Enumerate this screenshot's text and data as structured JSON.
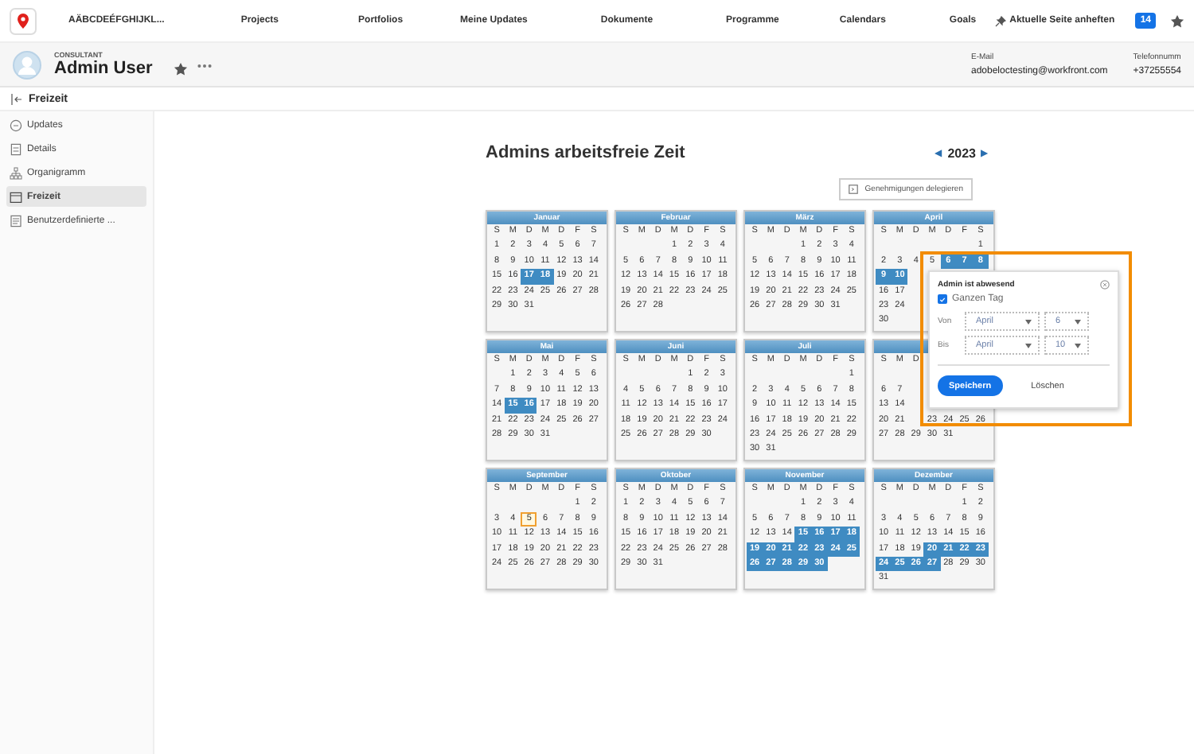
{
  "top_nav": {
    "brand": "AÄBCDEÉFGHIJKL...",
    "items": [
      "Projects",
      "Portfolios",
      "Meine Updates",
      "Dokumente",
      "Programme",
      "Calendars",
      "Goals"
    ],
    "pin": "Aktuelle Seite anheften",
    "badge": "14"
  },
  "profile": {
    "role": "CONSULTANT",
    "name": "Admin User",
    "fields": [
      {
        "label": "E-Mail",
        "value": "adobeloctesting@workfront.com"
      },
      {
        "label": "Telefonnumm",
        "value": "+37255554"
      }
    ]
  },
  "section": {
    "title": "Freizeit"
  },
  "sidebar": {
    "items": [
      {
        "label": "Updates",
        "selected": false
      },
      {
        "label": "Details",
        "selected": false
      },
      {
        "label": "Organigramm",
        "selected": false
      },
      {
        "label": "Freizeit",
        "selected": true
      },
      {
        "label": "Benutzerdefinierte ...",
        "selected": false
      }
    ]
  },
  "page": {
    "title": "Admins arbeitsfreie Zeit",
    "year": "2023",
    "prev": "◀",
    "next": "▶",
    "delegate_button": "Genehmigungen delegieren"
  },
  "months": [
    {
      "title": "Januar",
      "weekdays": [
        "S",
        "M",
        "D",
        "M",
        "D",
        "F",
        "S"
      ],
      "weeks": [
        [
          {
            "day": "1",
            "kind": "plain"
          },
          {
            "day": "2",
            "kind": "plain"
          },
          {
            "day": "3",
            "kind": "plain"
          },
          {
            "day": "4",
            "kind": "plain"
          },
          {
            "day": "5",
            "kind": "plain"
          },
          {
            "day": "6",
            "kind": "plain"
          },
          {
            "day": "7",
            "kind": "plain"
          }
        ],
        [
          {
            "day": "8",
            "kind": "plain"
          },
          {
            "day": "9",
            "kind": "plain"
          },
          {
            "day": "10",
            "kind": "plain"
          },
          {
            "day": "11",
            "kind": "plain"
          },
          {
            "day": "12",
            "kind": "plain"
          },
          {
            "day": "13",
            "kind": "plain"
          },
          {
            "day": "14",
            "kind": "plain"
          }
        ],
        [
          {
            "day": "15",
            "kind": "plain"
          },
          {
            "day": "16",
            "kind": "plain"
          },
          {
            "day": "17",
            "kind": "off"
          },
          {
            "day": "18",
            "kind": "off"
          },
          {
            "day": "19",
            "kind": "plain"
          },
          {
            "day": "20",
            "kind": "plain"
          },
          {
            "day": "21",
            "kind": "plain"
          }
        ],
        [
          {
            "day": "22",
            "kind": "plain"
          },
          {
            "day": "23",
            "kind": "plain"
          },
          {
            "day": "24",
            "kind": "plain"
          },
          {
            "day": "25",
            "kind": "plain"
          },
          {
            "day": "26",
            "kind": "plain"
          },
          {
            "day": "27",
            "kind": "plain"
          },
          {
            "day": "28",
            "kind": "plain"
          }
        ],
        [
          {
            "day": "29",
            "kind": "plain"
          },
          {
            "day": "30",
            "kind": "plain"
          },
          {
            "day": "31",
            "kind": "plain"
          }
        ]
      ]
    },
    {
      "title": "Februar",
      "weekdays": [
        "S",
        "M",
        "D",
        "M",
        "D",
        "F",
        "S"
      ],
      "weeks": [
        [
          {
            "kind": "blank"
          },
          {
            "kind": "blank"
          },
          {
            "kind": "blank"
          },
          {
            "day": "1",
            "kind": "plain"
          },
          {
            "day": "2",
            "kind": "plain"
          },
          {
            "day": "3",
            "kind": "plain"
          },
          {
            "day": "4",
            "kind": "plain"
          }
        ],
        [
          {
            "day": "5",
            "kind": "plain"
          },
          {
            "day": "6",
            "kind": "plain"
          },
          {
            "day": "7",
            "kind": "plain"
          },
          {
            "day": "8",
            "kind": "plain"
          },
          {
            "day": "9",
            "kind": "plain"
          },
          {
            "day": "10",
            "kind": "plain"
          },
          {
            "day": "11",
            "kind": "plain"
          }
        ],
        [
          {
            "day": "12",
            "kind": "plain"
          },
          {
            "day": "13",
            "kind": "plain"
          },
          {
            "day": "14",
            "kind": "plain"
          },
          {
            "day": "15",
            "kind": "plain"
          },
          {
            "day": "16",
            "kind": "plain"
          },
          {
            "day": "17",
            "kind": "plain"
          },
          {
            "day": "18",
            "kind": "plain"
          }
        ],
        [
          {
            "day": "19",
            "kind": "plain"
          },
          {
            "day": "20",
            "kind": "plain"
          },
          {
            "day": "21",
            "kind": "plain"
          },
          {
            "day": "22",
            "kind": "plain"
          },
          {
            "day": "23",
            "kind": "plain"
          },
          {
            "day": "24",
            "kind": "plain"
          },
          {
            "day": "25",
            "kind": "plain"
          }
        ],
        [
          {
            "day": "26",
            "kind": "plain"
          },
          {
            "day": "27",
            "kind": "plain"
          },
          {
            "day": "28",
            "kind": "plain"
          }
        ]
      ]
    },
    {
      "title": "März",
      "weekdays": [
        "S",
        "M",
        "D",
        "M",
        "D",
        "F",
        "S"
      ],
      "weeks": [
        [
          {
            "kind": "blank"
          },
          {
            "kind": "blank"
          },
          {
            "kind": "blank"
          },
          {
            "day": "1",
            "kind": "plain"
          },
          {
            "day": "2",
            "kind": "plain"
          },
          {
            "day": "3",
            "kind": "plain"
          },
          {
            "day": "4",
            "kind": "plain"
          }
        ],
        [
          {
            "day": "5",
            "kind": "plain"
          },
          {
            "day": "6",
            "kind": "plain"
          },
          {
            "day": "7",
            "kind": "plain"
          },
          {
            "day": "8",
            "kind": "plain"
          },
          {
            "day": "9",
            "kind": "plain"
          },
          {
            "day": "10",
            "kind": "plain"
          },
          {
            "day": "11",
            "kind": "plain"
          }
        ],
        [
          {
            "day": "12",
            "kind": "plain"
          },
          {
            "day": "13",
            "kind": "plain"
          },
          {
            "day": "14",
            "kind": "plain"
          },
          {
            "day": "15",
            "kind": "plain"
          },
          {
            "day": "16",
            "kind": "plain"
          },
          {
            "day": "17",
            "kind": "plain"
          },
          {
            "day": "18",
            "kind": "plain"
          }
        ],
        [
          {
            "day": "19",
            "kind": "plain"
          },
          {
            "day": "20",
            "kind": "plain"
          },
          {
            "day": "21",
            "kind": "plain"
          },
          {
            "day": "22",
            "kind": "plain"
          },
          {
            "day": "23",
            "kind": "plain"
          },
          {
            "day": "24",
            "kind": "plain"
          },
          {
            "day": "25",
            "kind": "plain"
          }
        ],
        [
          {
            "day": "26",
            "kind": "plain"
          },
          {
            "day": "27",
            "kind": "plain"
          },
          {
            "day": "28",
            "kind": "plain"
          },
          {
            "day": "29",
            "kind": "plain"
          },
          {
            "day": "30",
            "kind": "plain"
          },
          {
            "day": "31",
            "kind": "plain"
          }
        ]
      ]
    },
    {
      "title": "April",
      "weekdays": [
        "S",
        "M",
        "D",
        "M",
        "D",
        "F",
        "S"
      ],
      "weeks": [
        [
          {
            "kind": "blank"
          },
          {
            "kind": "blank"
          },
          {
            "kind": "blank"
          },
          {
            "kind": "blank"
          },
          {
            "kind": "blank"
          },
          {
            "kind": "blank"
          },
          {
            "day": "1",
            "kind": "plain"
          }
        ],
        [
          {
            "day": "2",
            "kind": "plain"
          },
          {
            "day": "3",
            "kind": "plain"
          },
          {
            "day": "4",
            "kind": "plain"
          },
          {
            "day": "5",
            "kind": "plain"
          },
          {
            "day": "6",
            "kind": "off"
          },
          {
            "day": "7",
            "kind": "off"
          },
          {
            "day": "8",
            "kind": "off"
          }
        ],
        [
          {
            "day": "9",
            "kind": "off"
          },
          {
            "day": "10",
            "kind": "off"
          }
        ],
        [
          {
            "day": "16",
            "kind": "plain"
          },
          {
            "day": "17",
            "kind": "plain"
          }
        ],
        [
          {
            "day": "23",
            "kind": "plain"
          },
          {
            "day": "24",
            "kind": "plain"
          }
        ],
        [
          {
            "day": "30",
            "kind": "plain"
          }
        ]
      ]
    },
    {
      "title": "Mai",
      "weekdays": [
        "S",
        "M",
        "D",
        "M",
        "D",
        "F",
        "S"
      ],
      "weeks": [
        [
          {
            "kind": "blank"
          },
          {
            "day": "1",
            "kind": "plain"
          },
          {
            "day": "2",
            "kind": "plain"
          },
          {
            "day": "3",
            "kind": "plain"
          },
          {
            "day": "4",
            "kind": "plain"
          },
          {
            "day": "5",
            "kind": "plain"
          },
          {
            "day": "6",
            "kind": "plain"
          }
        ],
        [
          {
            "day": "7",
            "kind": "plain"
          },
          {
            "day": "8",
            "kind": "plain"
          },
          {
            "day": "9",
            "kind": "plain"
          },
          {
            "day": "10",
            "kind": "plain"
          },
          {
            "day": "11",
            "kind": "plain"
          },
          {
            "day": "12",
            "kind": "plain"
          },
          {
            "day": "13",
            "kind": "plain"
          }
        ],
        [
          {
            "day": "14",
            "kind": "plain"
          },
          {
            "day": "15",
            "kind": "off"
          },
          {
            "day": "16",
            "kind": "off"
          },
          {
            "day": "17",
            "kind": "plain"
          },
          {
            "day": "18",
            "kind": "plain"
          },
          {
            "day": "19",
            "kind": "plain"
          },
          {
            "day": "20",
            "kind": "plain"
          }
        ],
        [
          {
            "day": "21",
            "kind": "plain"
          },
          {
            "day": "22",
            "kind": "plain"
          },
          {
            "day": "23",
            "kind": "plain"
          },
          {
            "day": "24",
            "kind": "plain"
          },
          {
            "day": "25",
            "kind": "plain"
          },
          {
            "day": "26",
            "kind": "plain"
          },
          {
            "day": "27",
            "kind": "plain"
          }
        ],
        [
          {
            "day": "28",
            "kind": "plain"
          },
          {
            "day": "29",
            "kind": "plain"
          },
          {
            "day": "30",
            "kind": "plain"
          },
          {
            "day": "31",
            "kind": "plain"
          }
        ]
      ]
    },
    {
      "title": "Juni",
      "weekdays": [
        "S",
        "M",
        "D",
        "M",
        "D",
        "F",
        "S"
      ],
      "weeks": [
        [
          {
            "kind": "blank"
          },
          {
            "kind": "blank"
          },
          {
            "kind": "blank"
          },
          {
            "kind": "blank"
          },
          {
            "day": "1",
            "kind": "plain"
          },
          {
            "day": "2",
            "kind": "plain"
          },
          {
            "day": "3",
            "kind": "plain"
          }
        ],
        [
          {
            "day": "4",
            "kind": "plain"
          },
          {
            "day": "5",
            "kind": "plain"
          },
          {
            "day": "6",
            "kind": "plain"
          },
          {
            "day": "7",
            "kind": "plain"
          },
          {
            "day": "8",
            "kind": "plain"
          },
          {
            "day": "9",
            "kind": "plain"
          },
          {
            "day": "10",
            "kind": "plain"
          }
        ],
        [
          {
            "day": "11",
            "kind": "plain"
          },
          {
            "day": "12",
            "kind": "plain"
          },
          {
            "day": "13",
            "kind": "plain"
          },
          {
            "day": "14",
            "kind": "plain"
          },
          {
            "day": "15",
            "kind": "plain"
          },
          {
            "day": "16",
            "kind": "plain"
          },
          {
            "day": "17",
            "kind": "plain"
          }
        ],
        [
          {
            "day": "18",
            "kind": "plain"
          },
          {
            "day": "19",
            "kind": "plain"
          },
          {
            "day": "20",
            "kind": "plain"
          },
          {
            "day": "21",
            "kind": "plain"
          },
          {
            "day": "22",
            "kind": "plain"
          },
          {
            "day": "23",
            "kind": "plain"
          },
          {
            "day": "24",
            "kind": "plain"
          }
        ],
        [
          {
            "day": "25",
            "kind": "plain"
          },
          {
            "day": "26",
            "kind": "plain"
          },
          {
            "day": "27",
            "kind": "plain"
          },
          {
            "day": "28",
            "kind": "plain"
          },
          {
            "day": "29",
            "kind": "plain"
          },
          {
            "day": "30",
            "kind": "plain"
          }
        ]
      ]
    },
    {
      "title": "Juli",
      "weekdays": [
        "S",
        "M",
        "D",
        "M",
        "D",
        "F",
        "S"
      ],
      "weeks": [
        [
          {
            "kind": "blank"
          },
          {
            "kind": "blank"
          },
          {
            "kind": "blank"
          },
          {
            "kind": "blank"
          },
          {
            "kind": "blank"
          },
          {
            "kind": "blank"
          },
          {
            "day": "1",
            "kind": "plain"
          }
        ],
        [
          {
            "day": "2",
            "kind": "plain"
          },
          {
            "day": "3",
            "kind": "plain"
          },
          {
            "day": "4",
            "kind": "plain"
          },
          {
            "day": "5",
            "kind": "plain"
          },
          {
            "day": "6",
            "kind": "plain"
          },
          {
            "day": "7",
            "kind": "plain"
          },
          {
            "day": "8",
            "kind": "plain"
          }
        ],
        [
          {
            "day": "9",
            "kind": "plain"
          },
          {
            "day": "10",
            "kind": "plain"
          },
          {
            "day": "11",
            "kind": "plain"
          },
          {
            "day": "12",
            "kind": "plain"
          },
          {
            "day": "13",
            "kind": "plain"
          },
          {
            "day": "14",
            "kind": "plain"
          },
          {
            "day": "15",
            "kind": "plain"
          }
        ],
        [
          {
            "day": "16",
            "kind": "plain"
          },
          {
            "day": "17",
            "kind": "plain"
          },
          {
            "day": "18",
            "kind": "plain"
          },
          {
            "day": "19",
            "kind": "plain"
          },
          {
            "day": "20",
            "kind": "plain"
          },
          {
            "day": "21",
            "kind": "plain"
          },
          {
            "day": "22",
            "kind": "plain"
          }
        ],
        [
          {
            "day": "23",
            "kind": "plain"
          },
          {
            "day": "24",
            "kind": "plain"
          },
          {
            "day": "25",
            "kind": "plain"
          },
          {
            "day": "26",
            "kind": "plain"
          },
          {
            "day": "27",
            "kind": "plain"
          },
          {
            "day": "28",
            "kind": "plain"
          },
          {
            "day": "29",
            "kind": "plain"
          }
        ],
        [
          {
            "day": "30",
            "kind": "plain"
          },
          {
            "day": "31",
            "kind": "plain"
          }
        ]
      ]
    },
    {
      "weekdays": [
        "S",
        "M",
        "D"
      ],
      "weeks": [
        [
          {
            "kind": "blank"
          }
        ],
        [
          {
            "day": "6",
            "kind": "plain"
          },
          {
            "day": "7",
            "kind": "plain"
          }
        ],
        [
          {
            "day": "13",
            "kind": "plain"
          },
          {
            "day": "14",
            "kind": "plain"
          }
        ],
        [
          {
            "day": "20",
            "kind": "plain"
          },
          {
            "day": "21",
            "kind": "plain"
          },
          {
            "kind": "blank"
          },
          {
            "day": "23",
            "kind": "plain"
          },
          {
            "day": "24",
            "kind": "plain"
          },
          {
            "day": "25",
            "kind": "plain"
          },
          {
            "day": "26",
            "kind": "plain"
          }
        ],
        [
          {
            "day": "27",
            "kind": "plain"
          },
          {
            "day": "28",
            "kind": "plain"
          },
          {
            "day": "29",
            "kind": "plain"
          },
          {
            "day": "30",
            "kind": "plain"
          },
          {
            "day": "31",
            "kind": "plain"
          }
        ]
      ]
    },
    {
      "title": "September",
      "weekdays": [
        "S",
        "M",
        "D",
        "M",
        "D",
        "F",
        "S"
      ],
      "weeks": [
        [
          {
            "kind": "blank"
          },
          {
            "kind": "blank"
          },
          {
            "kind": "blank"
          },
          {
            "kind": "blank"
          },
          {
            "kind": "blank"
          },
          {
            "day": "1",
            "kind": "plain"
          },
          {
            "day": "2",
            "kind": "plain"
          }
        ],
        [
          {
            "day": "3",
            "kind": "plain"
          },
          {
            "day": "4",
            "kind": "plain"
          },
          {
            "day": "5",
            "kind": "today"
          },
          {
            "day": "6",
            "kind": "plain"
          },
          {
            "day": "7",
            "kind": "plain"
          },
          {
            "day": "8",
            "kind": "plain"
          },
          {
            "day": "9",
            "kind": "plain"
          }
        ],
        [
          {
            "day": "10",
            "kind": "plain"
          },
          {
            "day": "11",
            "kind": "plain"
          },
          {
            "day": "12",
            "kind": "plain"
          },
          {
            "day": "13",
            "kind": "plain"
          },
          {
            "day": "14",
            "kind": "plain"
          },
          {
            "day": "15",
            "kind": "plain"
          },
          {
            "day": "16",
            "kind": "plain"
          }
        ],
        [
          {
            "day": "17",
            "kind": "plain"
          },
          {
            "day": "18",
            "kind": "plain"
          },
          {
            "day": "19",
            "kind": "plain"
          },
          {
            "day": "20",
            "kind": "plain"
          },
          {
            "day": "21",
            "kind": "plain"
          },
          {
            "day": "22",
            "kind": "plain"
          },
          {
            "day": "23",
            "kind": "plain"
          }
        ],
        [
          {
            "day": "24",
            "kind": "plain"
          },
          {
            "day": "25",
            "kind": "plain"
          },
          {
            "day": "26",
            "kind": "plain"
          },
          {
            "day": "27",
            "kind": "plain"
          },
          {
            "day": "28",
            "kind": "plain"
          },
          {
            "day": "29",
            "kind": "plain"
          },
          {
            "day": "30",
            "kind": "plain"
          }
        ]
      ]
    },
    {
      "title": "Oktober",
      "weekdays": [
        "S",
        "M",
        "D",
        "M",
        "D",
        "F",
        "S"
      ],
      "weeks": [
        [
          {
            "day": "1",
            "kind": "plain"
          },
          {
            "day": "2",
            "kind": "plain"
          },
          {
            "day": "3",
            "kind": "plain"
          },
          {
            "day": "4",
            "kind": "plain"
          },
          {
            "day": "5",
            "kind": "plain"
          },
          {
            "day": "6",
            "kind": "plain"
          },
          {
            "day": "7",
            "kind": "plain"
          }
        ],
        [
          {
            "day": "8",
            "kind": "plain"
          },
          {
            "day": "9",
            "kind": "plain"
          },
          {
            "day": "10",
            "kind": "plain"
          },
          {
            "day": "11",
            "kind": "plain"
          },
          {
            "day": "12",
            "kind": "plain"
          },
          {
            "day": "13",
            "kind": "plain"
          },
          {
            "day": "14",
            "kind": "plain"
          }
        ],
        [
          {
            "day": "15",
            "kind": "plain"
          },
          {
            "day": "16",
            "kind": "plain"
          },
          {
            "day": "17",
            "kind": "plain"
          },
          {
            "day": "18",
            "kind": "plain"
          },
          {
            "day": "19",
            "kind": "plain"
          },
          {
            "day": "20",
            "kind": "plain"
          },
          {
            "day": "21",
            "kind": "plain"
          }
        ],
        [
          {
            "day": "22",
            "kind": "plain"
          },
          {
            "day": "23",
            "kind": "plain"
          },
          {
            "day": "24",
            "kind": "plain"
          },
          {
            "day": "25",
            "kind": "plain"
          },
          {
            "day": "26",
            "kind": "plain"
          },
          {
            "day": "27",
            "kind": "plain"
          },
          {
            "day": "28",
            "kind": "plain"
          }
        ],
        [
          {
            "day": "29",
            "kind": "plain"
          },
          {
            "day": "30",
            "kind": "plain"
          },
          {
            "day": "31",
            "kind": "plain"
          }
        ]
      ]
    },
    {
      "title": "November",
      "weekdays": [
        "S",
        "M",
        "D",
        "M",
        "D",
        "F",
        "S"
      ],
      "weeks": [
        [
          {
            "kind": "blank"
          },
          {
            "kind": "blank"
          },
          {
            "kind": "blank"
          },
          {
            "day": "1",
            "kind": "plain"
          },
          {
            "day": "2",
            "kind": "plain"
          },
          {
            "day": "3",
            "kind": "plain"
          },
          {
            "day": "4",
            "kind": "plain"
          }
        ],
        [
          {
            "day": "5",
            "kind": "plain"
          },
          {
            "day": "6",
            "kind": "plain"
          },
          {
            "day": "7",
            "kind": "plain"
          },
          {
            "day": "8",
            "kind": "plain"
          },
          {
            "day": "9",
            "kind": "plain"
          },
          {
            "day": "10",
            "kind": "plain"
          },
          {
            "day": "11",
            "kind": "plain"
          }
        ],
        [
          {
            "day": "12",
            "kind": "plain"
          },
          {
            "day": "13",
            "kind": "plain"
          },
          {
            "day": "14",
            "kind": "plain"
          },
          {
            "day": "15",
            "kind": "off"
          },
          {
            "day": "16",
            "kind": "off"
          },
          {
            "day": "17",
            "kind": "off"
          },
          {
            "day": "18",
            "kind": "off"
          }
        ],
        [
          {
            "day": "19",
            "kind": "off"
          },
          {
            "day": "20",
            "kind": "off"
          },
          {
            "day": "21",
            "kind": "off"
          },
          {
            "day": "22",
            "kind": "off"
          },
          {
            "day": "23",
            "kind": "off"
          },
          {
            "day": "24",
            "kind": "off"
          },
          {
            "day": "25",
            "kind": "off"
          }
        ],
        [
          {
            "day": "26",
            "kind": "off"
          },
          {
            "day": "27",
            "kind": "off"
          },
          {
            "day": "28",
            "kind": "off"
          },
          {
            "day": "29",
            "kind": "off"
          },
          {
            "day": "30",
            "kind": "off"
          }
        ]
      ]
    },
    {
      "title": "Dezember",
      "weekdays": [
        "S",
        "M",
        "D",
        "M",
        "D",
        "F",
        "S"
      ],
      "weeks": [
        [
          {
            "kind": "blank"
          },
          {
            "kind": "blank"
          },
          {
            "kind": "blank"
          },
          {
            "kind": "blank"
          },
          {
            "kind": "blank"
          },
          {
            "day": "1",
            "kind": "plain"
          },
          {
            "day": "2",
            "kind": "plain"
          }
        ],
        [
          {
            "day": "3",
            "kind": "plain"
          },
          {
            "day": "4",
            "kind": "plain"
          },
          {
            "day": "5",
            "kind": "plain"
          },
          {
            "day": "6",
            "kind": "plain"
          },
          {
            "day": "7",
            "kind": "plain"
          },
          {
            "day": "8",
            "kind": "plain"
          },
          {
            "day": "9",
            "kind": "plain"
          }
        ],
        [
          {
            "day": "10",
            "kind": "plain"
          },
          {
            "day": "11",
            "kind": "plain"
          },
          {
            "day": "12",
            "kind": "plain"
          },
          {
            "day": "13",
            "kind": "plain"
          },
          {
            "day": "14",
            "kind": "plain"
          },
          {
            "day": "15",
            "kind": "plain"
          },
          {
            "day": "16",
            "kind": "plain"
          }
        ],
        [
          {
            "day": "17",
            "kind": "plain"
          },
          {
            "day": "18",
            "kind": "plain"
          },
          {
            "day": "19",
            "kind": "plain"
          },
          {
            "day": "20",
            "kind": "off"
          },
          {
            "day": "21",
            "kind": "off"
          },
          {
            "day": "22",
            "kind": "off"
          },
          {
            "day": "23",
            "kind": "off"
          }
        ],
        [
          {
            "day": "24",
            "kind": "off"
          },
          {
            "day": "25",
            "kind": "off"
          },
          {
            "day": "26",
            "kind": "off"
          },
          {
            "day": "27",
            "kind": "off"
          },
          {
            "day": "28",
            "kind": "plain"
          },
          {
            "day": "29",
            "kind": "plain"
          },
          {
            "day": "30",
            "kind": "plain"
          }
        ],
        [
          {
            "day": "31",
            "kind": "plain"
          }
        ]
      ]
    }
  ],
  "popup": {
    "title": "Admin ist abwesend",
    "all_day": {
      "label": "Ganzen Tag",
      "checked": true
    },
    "from": {
      "label": "Von",
      "month": "April",
      "day": "6"
    },
    "to": {
      "label": "Bis",
      "month": "April",
      "day": "10"
    },
    "save": "Speichern",
    "delete": "Löschen"
  }
}
